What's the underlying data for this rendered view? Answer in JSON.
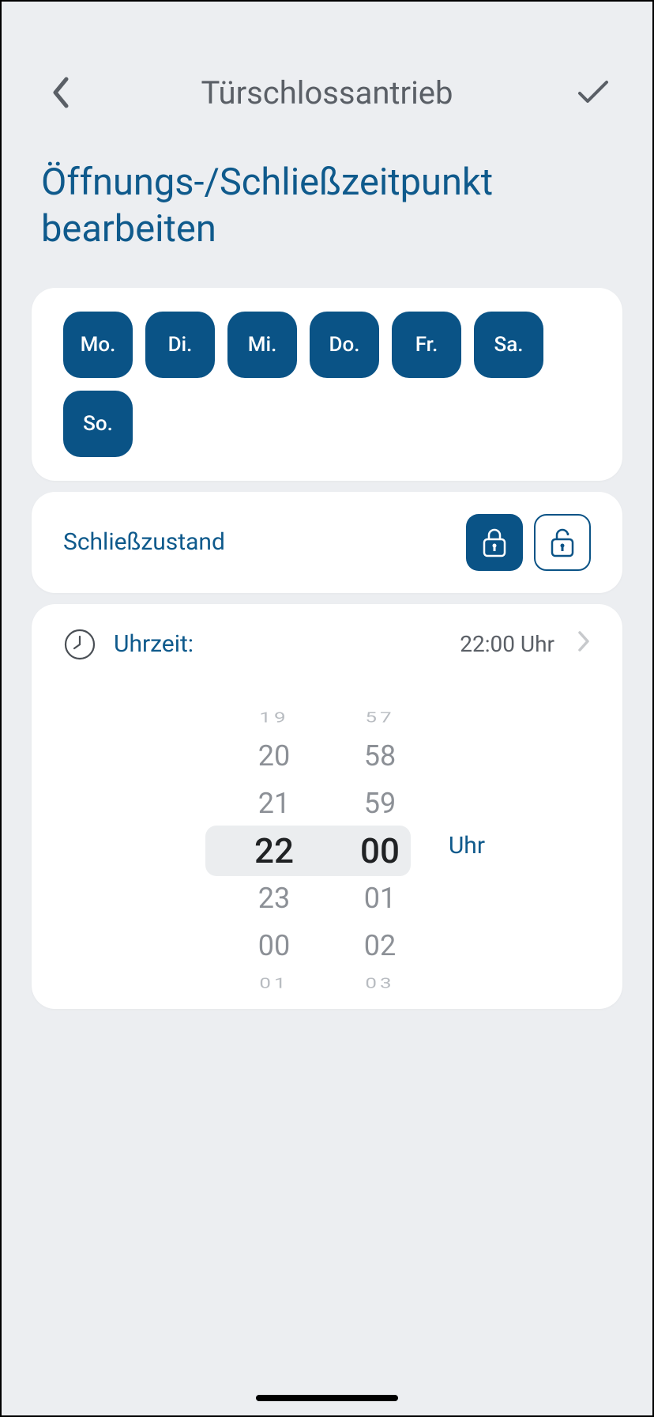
{
  "header": {
    "title": "Türschlossantrieb"
  },
  "page_title": "Öffnungs-/Schließzeitpunkt bearbeiten",
  "days": [
    "Mo.",
    "Di.",
    "Mi.",
    "Do.",
    "Fr.",
    "Sa.",
    "So."
  ],
  "lock": {
    "label": "Schließzustand",
    "selected": "locked"
  },
  "time": {
    "label": "Uhrzeit:",
    "value_display": "22:00 Uhr",
    "unit": "Uhr",
    "picker": {
      "hours": [
        "19",
        "20",
        "21",
        "22",
        "23",
        "00",
        "01"
      ],
      "minutes": [
        "57",
        "58",
        "59",
        "00",
        "01",
        "02",
        "03"
      ],
      "selected_index": 3
    }
  }
}
